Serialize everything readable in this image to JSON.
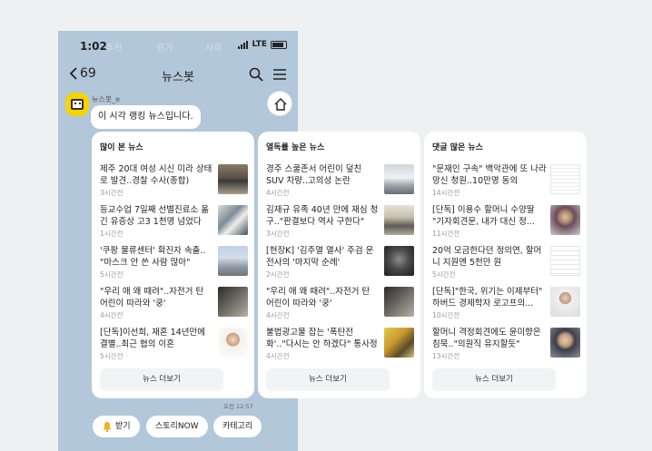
{
  "status": {
    "time": "1:02",
    "network": "LTE",
    "ghost_tabs": [
      "추천",
      "원가",
      "사회"
    ]
  },
  "nav": {
    "back_count": "69",
    "title": "뉴스봇"
  },
  "bot": {
    "name": "뉴스봇_e",
    "message": "이 시각 랭킹 뉴스입니다."
  },
  "cards": [
    {
      "heading": "많이 본 뉴스",
      "items": [
        {
          "title": "제주 20대 여성 시신 미라 상태로 발견..경찰 수사(종합)",
          "ago": "3시간전"
        },
        {
          "title": "등교수업 7일째 선별진료소 옮긴 유증상 고3 1천명 넘었다",
          "ago": "1시간전"
        },
        {
          "title": "'쿠팡 물류센터' 확진자 속출.. \"마스크 안 쓴 사람 많아\"",
          "ago": "5시간전"
        },
        {
          "title": "\"우리 애 왜 때려\"..자전거 탄 어린이 따라와 '쿵'",
          "ago": "4시간전"
        },
        {
          "title": "[단독]이선희, 재혼 14년만에 결별..최근 협의 이혼",
          "ago": "5시간전"
        }
      ],
      "more": "뉴스 더보기"
    },
    {
      "heading": "열독률 높은 뉴스",
      "items": [
        {
          "title": "경주 스쿨존서 어린이 덮친 SUV 차량..고의성 논란",
          "ago": "4시간전"
        },
        {
          "title": "김재규 유족 40년 만에 재심 청구..\"판결보다 역사 구한다\"",
          "ago": "3시간전"
        },
        {
          "title": "[현장K] '김주열 열사' 주검 운전사의 '마지막 순례'",
          "ago": "2시간전"
        },
        {
          "title": "\"우리 애 왜 때려\"..자전거 탄 어린이 따라와 '쿵'",
          "ago": "4시간전"
        },
        {
          "title": "불법광고물 잡는 '폭탄전화'..\"다시는 안 하겠다\" 통사정",
          "ago": "4시간전"
        }
      ],
      "more": "뉴스 더보기"
    },
    {
      "heading": "댓글 많은 뉴스",
      "items": [
        {
          "title": "\"문재인 구속\" 백악관에 또 나라망신 청원..10만명 동의",
          "ago": "14시간전"
        },
        {
          "title": "[단독] 이용수 할머니 수양딸 \"기자회견문, 내가 대신 정...",
          "ago": "11시간전"
        },
        {
          "title": "20억 모금한다던 정의연, 할머니 지원엔 5천만 원",
          "ago": "5시간전"
        },
        {
          "title": "[단독]\"한국, 위기는 이제부터\" 하버드 경제학자 로고프의...",
          "ago": "10시간전"
        },
        {
          "title": "할머니 격정회견에도 윤미향은 침묵..\"의원직 유지할듯\"",
          "ago": "13시간전"
        }
      ],
      "more": "뉴스 더보기"
    }
  ],
  "timestamp": "오전 12:57",
  "quick_buttons": [
    "받기",
    "스토리NOW",
    "카테고리"
  ],
  "colors": {
    "chat_bg": "#b2c7d9",
    "avatar": "#f7d300"
  }
}
